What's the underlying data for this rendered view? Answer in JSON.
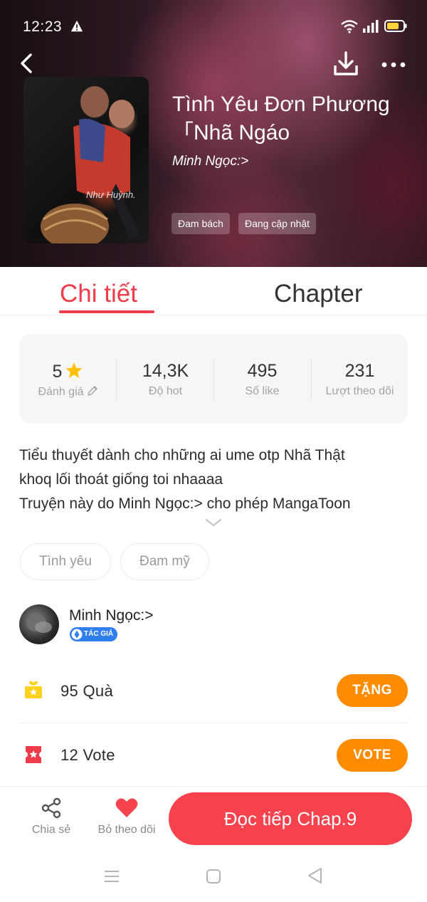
{
  "status_bar": {
    "time": "12:23"
  },
  "book": {
    "title": "Tình Yêu Đơn Phương 「Nhã Ngáo",
    "author": "Minh Ngọc:>",
    "cover_watermark": "Như Huỳnh.",
    "tags": [
      "Đam bách",
      "Đang cập nhật"
    ]
  },
  "tabs": [
    {
      "label": "Chi tiết",
      "active": true
    },
    {
      "label": "Chapter",
      "active": false
    }
  ],
  "stats": [
    {
      "value": "5",
      "label": "Đánh giá"
    },
    {
      "value": "14,3K",
      "label": "Độ hot"
    },
    {
      "value": "495",
      "label": "Số like"
    },
    {
      "value": "231",
      "label": "Lượt theo dõi"
    }
  ],
  "description": [
    "Tiểu thuyết dành cho những ai ume otp Nhã Thật",
    "khoq lối thoát giống toi nhaaaa",
    "Truyện này do Minh Ngọc:> cho phép MangaToon"
  ],
  "genres": [
    "Tình yêu",
    "Đam mỹ"
  ],
  "author_section": {
    "name": "Minh Ngọc:>",
    "badge": "TÁC GIẢ"
  },
  "gift": {
    "count": "95",
    "label": "Quà",
    "button": "TẶNG"
  },
  "vote": {
    "count": "12",
    "label": "Vote",
    "button": "VOTE"
  },
  "action_bar": {
    "share_label": "Chia sẻ",
    "unfollow_label": "Bỏ theo dõi",
    "read_label": "Đọc tiếp Chap.9"
  },
  "colors": {
    "accent_red": "#ee3c4a",
    "read_button": "#f5424c",
    "orange_button": "#ff8c00",
    "star": "#ffc107",
    "badge_blue": "#2f7ff1"
  },
  "icons": [
    "warning-icon",
    "wifi-icon",
    "signal-icon",
    "battery-icon",
    "back-icon",
    "download-icon",
    "more-icon",
    "star-icon",
    "pencil-icon",
    "chevron-down-icon",
    "gift-icon",
    "ticket-icon",
    "share-icon",
    "heart-icon"
  ]
}
